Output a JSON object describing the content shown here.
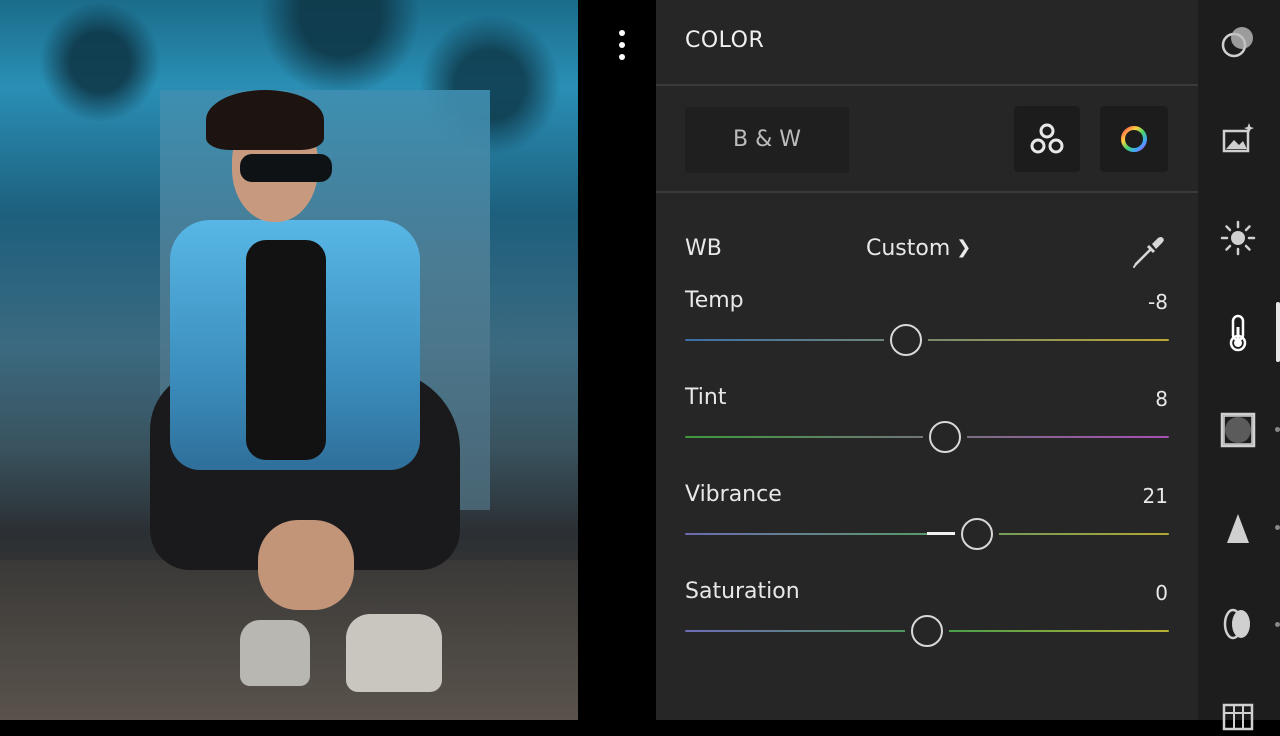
{
  "panel": {
    "title": "COLOR",
    "bw_label": "B & W",
    "wb": {
      "label": "WB",
      "value": "Custom"
    },
    "sliders": [
      {
        "name": "temp",
        "label": "Temp",
        "value": "-8",
        "position": 0.457
      },
      {
        "name": "tint",
        "label": "Tint",
        "value": "8",
        "position": 0.537
      },
      {
        "name": "vibrance",
        "label": "Vibrance",
        "value": "21",
        "position": 0.603,
        "filled_from": 0.5
      },
      {
        "name": "saturation",
        "label": "Saturation",
        "value": "0",
        "position": 0.5
      }
    ]
  },
  "colors": {
    "panel_bg": "#262626",
    "toolbar_bg": "#1d1d1d",
    "temp_track": [
      "#3a6fa8",
      "#b8a533"
    ],
    "tint_track": [
      "#3e9a3e",
      "#a64fb4"
    ],
    "vibrance_track": [
      "#6b6bb0",
      "#b3a534"
    ],
    "saturation_track": [
      "#6d6bb8",
      "#b8b036"
    ]
  },
  "toolbar": {
    "items": [
      {
        "name": "profile-icon"
      },
      {
        "name": "presets-icon"
      },
      {
        "name": "light-icon"
      },
      {
        "name": "color-icon",
        "active": true
      },
      {
        "name": "effects-icon"
      },
      {
        "name": "detail-icon"
      },
      {
        "name": "optics-icon"
      },
      {
        "name": "geometry-icon"
      }
    ]
  }
}
